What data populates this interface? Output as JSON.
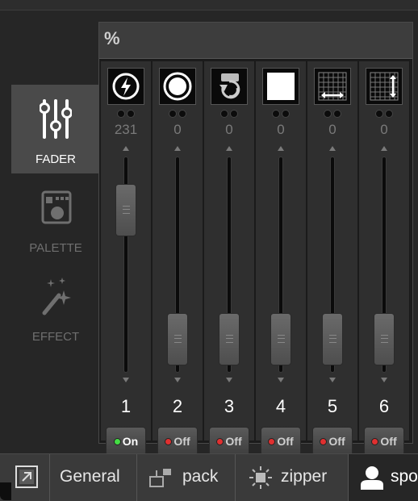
{
  "panel": {
    "header_symbol": "%"
  },
  "sidebar": {
    "modes": [
      {
        "label": "FADER",
        "icon": "fader-sliders-icon",
        "active": true
      },
      {
        "label": "PALETTE",
        "icon": "palette-icon",
        "active": false
      },
      {
        "label": "EFFECT",
        "icon": "magic-wand-icon",
        "active": false
      }
    ]
  },
  "channels": [
    {
      "number": "1",
      "value": "231",
      "level": 0.906,
      "icon": "strobe-lightning-icon",
      "state": "On",
      "led_color": "#44dd44"
    },
    {
      "number": "2",
      "value": "0",
      "level": 0,
      "icon": "shutter-circle-icon",
      "state": "Off",
      "led_color": "#e03030"
    },
    {
      "number": "3",
      "value": "0",
      "level": 0,
      "icon": "effect-off-icon",
      "state": "Off",
      "led_color": "#e03030"
    },
    {
      "number": "4",
      "value": "0",
      "level": 0,
      "icon": "dimmer-white-square-icon",
      "state": "Off",
      "led_color": "#e03030"
    },
    {
      "number": "5",
      "value": "0",
      "level": 0,
      "icon": "pan-grid-horizontal-icon",
      "state": "Off",
      "led_color": "#e03030"
    },
    {
      "number": "6",
      "value": "0",
      "level": 0,
      "icon": "tilt-grid-vertical-icon",
      "state": "Off",
      "led_color": "#e03030"
    }
  ],
  "bottom_tabs": [
    {
      "label": "",
      "icon": "group-toggle-icon"
    },
    {
      "label": "General",
      "icon": ""
    },
    {
      "label": "pack",
      "icon": "fixture-pack-icon"
    },
    {
      "label": "zipper",
      "icon": "zipper-light-icon"
    },
    {
      "label": "spo",
      "icon": "spot-person-icon"
    }
  ]
}
